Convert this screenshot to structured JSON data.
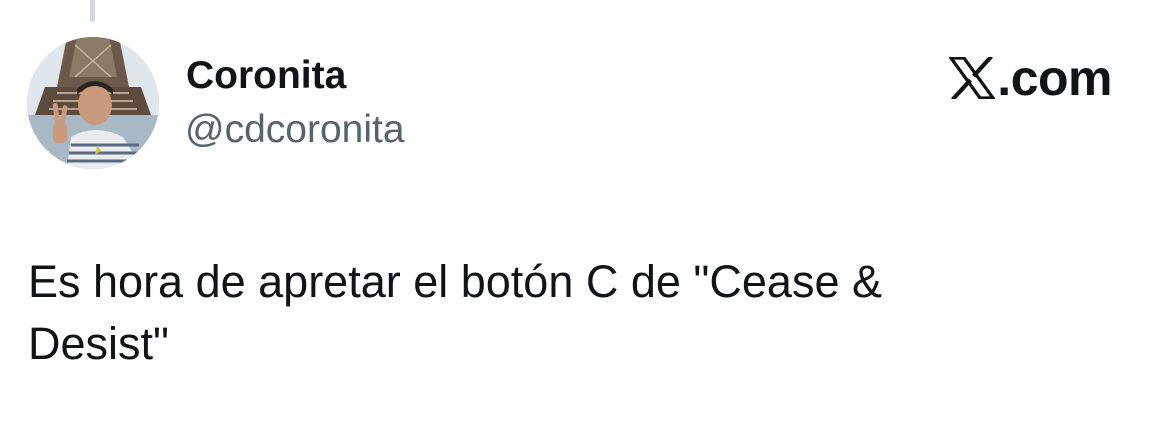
{
  "tweet": {
    "author": {
      "display_name": "Coronita",
      "handle": "@cdcoronita",
      "avatar_icon": "profile-photo"
    },
    "text": "Es hora de apretar el botón C de \"Cease &\nDesist\""
  },
  "brand": {
    "icon": "x-logo-icon",
    "domain_suffix": ".com"
  },
  "colors": {
    "text_primary": "#0f1419",
    "text_secondary": "#536471",
    "thread_line": "#cfd9de",
    "background": "#ffffff"
  }
}
